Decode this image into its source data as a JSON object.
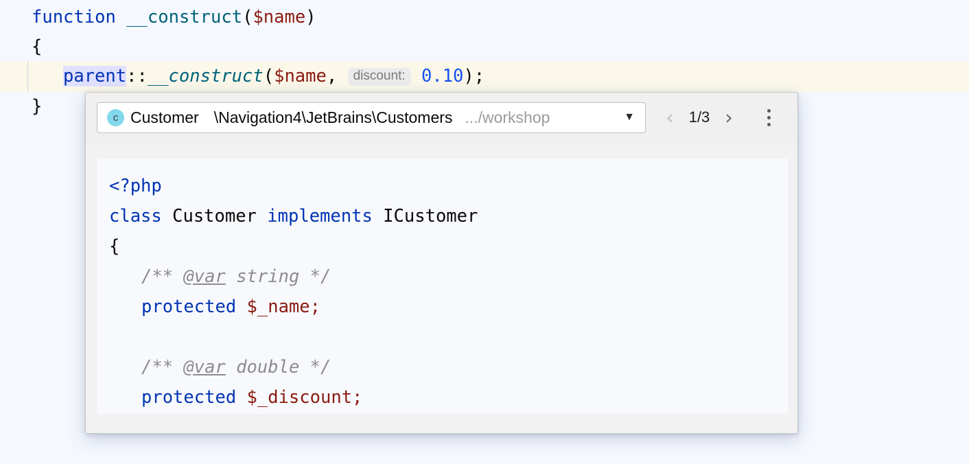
{
  "editor": {
    "background": "#f5f8fe",
    "caret_line_background": "#fbf8ea",
    "selection_background": "#e0e0ff",
    "lines": {
      "l1_kw": "function",
      "l1_sp": " ",
      "l1_fn": "__construct",
      "l1_paren_open": "(",
      "l1_var": "$name",
      "l1_paren_close": ")",
      "l2_brace": "{",
      "l3_parent": "parent",
      "l3_sep": "::",
      "l3_fn": "__construct",
      "l3_paren_open": "(",
      "l3_var": "$name",
      "l3_comma": ", ",
      "l3_inlay_label": "discount:",
      "l3_number": "0.10",
      "l3_tail": ");",
      "l4_brace": "}"
    }
  },
  "popup": {
    "breadcrumb": {
      "icon_letter": "c",
      "icon_color": "#82d8ec",
      "class_name": "Customer",
      "namespace": "\\Navigation4\\JetBrains\\Customers",
      "path": ".../workshop",
      "dropdown_caret": "▼"
    },
    "navigation": {
      "prev_icon": "‹",
      "counter": "1/3",
      "next_icon": "›",
      "kebab_tooltip": "More"
    },
    "code": {
      "l1_php_open": "<?php",
      "l2_kw_class": "class",
      "l2_name": " Customer ",
      "l2_kw_implements": "implements",
      "l2_iface": " ICustomer",
      "l3_brace_open": "{",
      "l4_doc_start": "/** ",
      "l4_doc_tag": "@var",
      "l4_doc_end": " string */",
      "l5_kw_protected": "protected",
      "l5_var": " $_name;",
      "l6_blank": "",
      "l7_doc_start": "/** ",
      "l7_doc_tag": "@var",
      "l7_doc_end": " double */",
      "l8_kw_protected": "protected",
      "l8_var": " $_discount;"
    }
  },
  "colors": {
    "keyword": "#0033b3",
    "function": "#00627a",
    "variable": "#8b1a10",
    "number": "#1750eb",
    "doc_comment": "#8c8c8c",
    "plain": "#080808"
  }
}
